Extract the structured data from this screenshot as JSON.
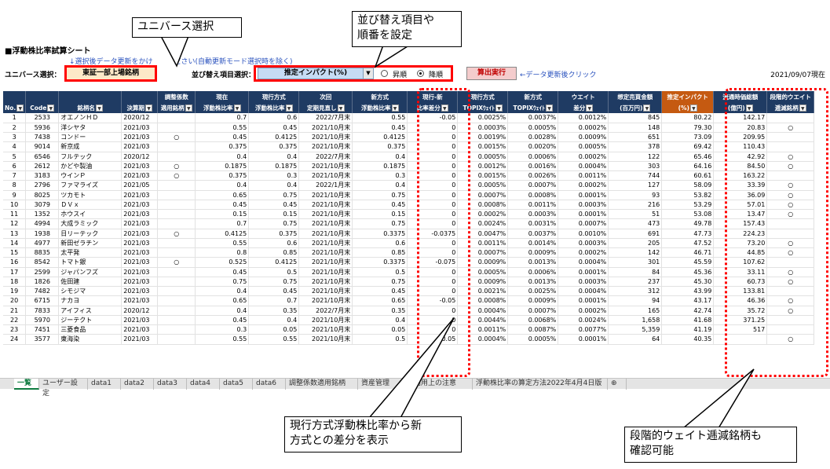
{
  "sheet_title": "■浮動株比率試算シート",
  "hint": "↓選択後データ更新をかけ　　　ださい(自動更新モード選択時を除く)",
  "universe_label": "ユニバース選択：",
  "universe_value": "東証一部上場銘柄",
  "sort_label": "並び替え項目選択：",
  "sort_value": "推定インパクト(%)",
  "sort_asc": "昇順",
  "sort_desc": "降順",
  "run_button": "算出実行",
  "run_note": "←データ更新後クリック",
  "date_note": "2021/09/07現在",
  "callouts": {
    "universe": "ユニバース選択",
    "sort": "並び替え項目や\n順番を設定",
    "diff": "現行方式浮動株比率から新\n方式との差分を表示",
    "step": "段階的ウェイト逓減銘柄も\n確認可能"
  },
  "columns": [
    "No.",
    "Code",
    "銘柄名",
    "決算期",
    "調整係数\n適用銘柄",
    "現在\n浮動株比率",
    "現行方式\n浮動株比率",
    "次回\n定期見直し",
    "新方式\n浮動株比率",
    "現行-新\n比率差分",
    "現行方式\nTOPIXｳｪｲﾄ",
    "新方式\nTOPIXｳｪｲﾄ",
    "ウエイト\n差分",
    "想定売買金額\n(百万円)",
    "推定インパクト\n(%)",
    "流通時価総額\n(億円)",
    "段階的ウエイト\n逓減銘柄"
  ],
  "rows": [
    [
      "1",
      "2533",
      "オエノンＨＤ",
      "2020/12",
      "",
      "0.7",
      "0.6",
      "2022/7月末",
      "0.55",
      "-0.05",
      "0.0025%",
      "0.0037%",
      "0.0012%",
      "845",
      "80.22",
      "142.17",
      ""
    ],
    [
      "2",
      "5936",
      "洋シヤタ",
      "2021/03",
      "",
      "0.55",
      "0.45",
      "2021/10月末",
      "0.45",
      "0",
      "0.0003%",
      "0.0005%",
      "0.0002%",
      "148",
      "79.30",
      "20.83",
      "○"
    ],
    [
      "3",
      "7438",
      "コンドー",
      "2021/03",
      "○",
      "0.45",
      "0.4125",
      "2021/10月末",
      "0.4125",
      "0",
      "0.0019%",
      "0.0028%",
      "0.0009%",
      "651",
      "73.09",
      "209.95",
      ""
    ],
    [
      "4",
      "9014",
      "新京成",
      "2021/03",
      "",
      "0.375",
      "0.375",
      "2021/10月末",
      "0.375",
      "0",
      "0.0015%",
      "0.0020%",
      "0.0005%",
      "378",
      "69.42",
      "110.43",
      ""
    ],
    [
      "5",
      "6546",
      "フルテック",
      "2020/12",
      "",
      "0.4",
      "0.4",
      "2022/7月末",
      "0.4",
      "0",
      "0.0005%",
      "0.0006%",
      "0.0002%",
      "122",
      "65.46",
      "42.92",
      "○"
    ],
    [
      "6",
      "2612",
      "かどや製油",
      "2021/03",
      "○",
      "0.1875",
      "0.1875",
      "2021/10月末",
      "0.1875",
      "0",
      "0.0012%",
      "0.0016%",
      "0.0004%",
      "303",
      "64.16",
      "84.50",
      "○"
    ],
    [
      "7",
      "3183",
      "ウインＰ",
      "2021/03",
      "○",
      "0.375",
      "0.3",
      "2021/10月末",
      "0.3",
      "0",
      "0.0015%",
      "0.0026%",
      "0.0011%",
      "744",
      "60.61",
      "163.22",
      ""
    ],
    [
      "8",
      "2796",
      "ファマライズ",
      "2021/05",
      "",
      "0.4",
      "0.4",
      "2022/1月末",
      "0.4",
      "0",
      "0.0005%",
      "0.0007%",
      "0.0002%",
      "127",
      "58.09",
      "33.39",
      "○"
    ],
    [
      "9",
      "8025",
      "ツカモト",
      "2021/03",
      "",
      "0.65",
      "0.75",
      "2021/10月末",
      "0.75",
      "0",
      "0.0007%",
      "0.0008%",
      "0.0001%",
      "93",
      "53.82",
      "36.09",
      "○"
    ],
    [
      "10",
      "3079",
      "ＤＶｘ",
      "2021/03",
      "",
      "0.45",
      "0.45",
      "2021/10月末",
      "0.45",
      "0",
      "0.0008%",
      "0.0011%",
      "0.0003%",
      "216",
      "53.29",
      "57.01",
      "○"
    ],
    [
      "11",
      "1352",
      "ホウスイ",
      "2021/03",
      "",
      "0.15",
      "0.15",
      "2021/10月末",
      "0.15",
      "0",
      "0.0002%",
      "0.0003%",
      "0.0001%",
      "51",
      "53.08",
      "13.47",
      "○"
    ],
    [
      "12",
      "4994",
      "大成ラミック",
      "2021/03",
      "",
      "0.7",
      "0.75",
      "2021/10月末",
      "0.75",
      "0",
      "0.0024%",
      "0.0031%",
      "0.0007%",
      "473",
      "49.78",
      "157.43",
      ""
    ],
    [
      "13",
      "1938",
      "日リーテック",
      "2021/03",
      "○",
      "0.4125",
      "0.375",
      "2021/10月末",
      "0.3375",
      "-0.0375",
      "0.0047%",
      "0.0037%",
      "0.0010%",
      "691",
      "47.73",
      "224.23",
      ""
    ],
    [
      "14",
      "4977",
      "新田ゼラチン",
      "2021/03",
      "",
      "0.55",
      "0.6",
      "2021/10月末",
      "0.6",
      "0",
      "0.0011%",
      "0.0014%",
      "0.0003%",
      "205",
      "47.52",
      "73.20",
      "○"
    ],
    [
      "15",
      "8835",
      "太平発",
      "2021/03",
      "",
      "0.8",
      "0.85",
      "2021/10月末",
      "0.85",
      "0",
      "0.0007%",
      "0.0009%",
      "0.0002%",
      "142",
      "46.71",
      "44.85",
      "○"
    ],
    [
      "16",
      "8542",
      "トマト銀",
      "2021/03",
      "○",
      "0.525",
      "0.4125",
      "2021/10月末",
      "0.3375",
      "-0.075",
      "0.0009%",
      "0.0013%",
      "0.0004%",
      "301",
      "45.59",
      "107.62",
      ""
    ],
    [
      "17",
      "2599",
      "ジャパンフズ",
      "2021/03",
      "",
      "0.45",
      "0.5",
      "2021/10月末",
      "0.5",
      "0",
      "0.0005%",
      "0.0006%",
      "0.0001%",
      "84",
      "45.36",
      "33.11",
      "○"
    ],
    [
      "18",
      "1826",
      "佐田建",
      "2021/03",
      "",
      "0.75",
      "0.75",
      "2021/10月末",
      "0.75",
      "0",
      "0.0009%",
      "0.0013%",
      "0.0003%",
      "237",
      "45.30",
      "60.73",
      "○"
    ],
    [
      "19",
      "7482",
      "シモジマ",
      "2021/03",
      "",
      "0.4",
      "0.45",
      "2021/10月末",
      "0.45",
      "0",
      "0.0021%",
      "0.0025%",
      "0.0004%",
      "312",
      "43.99",
      "133.81",
      ""
    ],
    [
      "20",
      "6715",
      "ナカヨ",
      "2021/03",
      "",
      "0.65",
      "0.7",
      "2021/10月末",
      "0.65",
      "-0.05",
      "0.0008%",
      "0.0009%",
      "0.0001%",
      "94",
      "43.17",
      "46.36",
      "○"
    ],
    [
      "21",
      "7833",
      "アイフィス",
      "2020/12",
      "",
      "0.4",
      "0.35",
      "2022/7月末",
      "0.35",
      "0",
      "0.0004%",
      "0.0007%",
      "0.0002%",
      "165",
      "42.74",
      "35.72",
      "○"
    ],
    [
      "22",
      "5970",
      "ジーテクト",
      "2021/03",
      "",
      "0.45",
      "0.4",
      "2021/10月末",
      "0.4",
      "0",
      "0.0044%",
      "0.0068%",
      "0.0024%",
      "1,658",
      "41.68",
      "371.25",
      ""
    ],
    [
      "23",
      "7451",
      "三菱食品",
      "2021/03",
      "",
      "0.3",
      "0.05",
      "2021/10月末",
      "0.05",
      "0",
      "0.0011%",
      "0.0087%",
      "0.0077%",
      "5,359",
      "41.19",
      "517",
      ""
    ],
    [
      "24",
      "3577",
      "東海染",
      "2021/03",
      "",
      "0.55",
      "0.55",
      "2021/10月末",
      "0.5",
      "-0.05",
      "0.0004%",
      "0.0005%",
      "0.0001%",
      "64",
      "40.35",
      "",
      "○"
    ]
  ],
  "tabs": [
    "一覧",
    "ユーザー設定",
    "data1",
    "data2",
    "data3",
    "data4",
    "data5",
    "data6",
    "調整係数適用銘柄",
    "資産管理",
    "ご利用上の注意",
    "浮動株比率の算定方法2022年4月4日版",
    "⊕"
  ],
  "icons": {
    "filter": "filter-dropdown-icon",
    "dropdown": "chevron-down-icon",
    "add_sheet": "plus-circle-icon"
  },
  "colors": {
    "header_bg": "#1f3b63",
    "impact_header_bg": "#c55a11",
    "highlight_red": "#ff0000",
    "universe_bg": "#fde9c8",
    "sort_bg": "#c6dcf4"
  }
}
